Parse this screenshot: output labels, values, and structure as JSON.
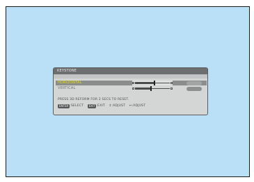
{
  "dialog": {
    "title": "KEYSTONE",
    "rows": [
      {
        "label": "HORIZONTAL",
        "selected": true,
        "value_fraction": 0.55
      },
      {
        "label": "VERTICAL",
        "selected": false,
        "value_fraction": 0.45
      }
    ],
    "hint": "PRESS 3D REFORM FOR 2 SECS TO RESET.",
    "footer": {
      "select_key": "ENTER",
      "select_label": ":SELECT",
      "exit_key": "EXIT",
      "exit_label": ":EXIT",
      "adjust_label": "↕:ADJUST",
      "adjust2_label": "↔:ADJUST"
    }
  },
  "colors": {
    "screen_bg": "#b9e0f6",
    "dialog_bg": "#d3d6d4",
    "title_bar": "#6d6e70",
    "selected_label": "#e9e000",
    "selected_row": "#8a8d8c"
  }
}
